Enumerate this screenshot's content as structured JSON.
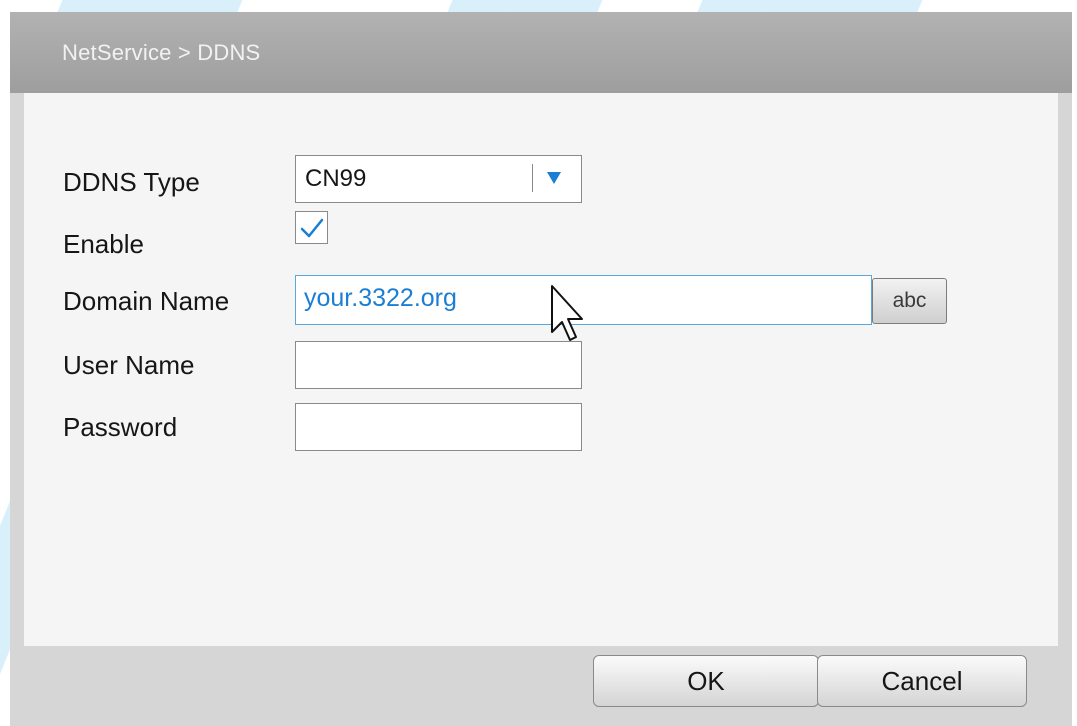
{
  "dialog": {
    "title": "NetService > DDNS"
  },
  "form": {
    "ddns_type_label": "DDNS Type",
    "ddns_type_value": "CN99",
    "enable_label": "Enable",
    "enable_checked": true,
    "domain_label": "Domain Name",
    "domain_value": "your.3322.org",
    "keyboard_button_label": "abc",
    "username_label": "User Name",
    "username_value": "",
    "password_label": "Password",
    "password_value": ""
  },
  "buttons": {
    "ok_label": "OK",
    "cancel_label": "Cancel"
  },
  "colors": {
    "accent": "#1a7fd4",
    "title_bar": "#a8a8a8",
    "panel": "#f5f5f5",
    "background_stripe": "#d9f0fb"
  },
  "icons": {
    "dropdown": "triangle-down-icon",
    "checkbox": "checkmark-icon",
    "pointer": "mouse-cursor-icon"
  }
}
